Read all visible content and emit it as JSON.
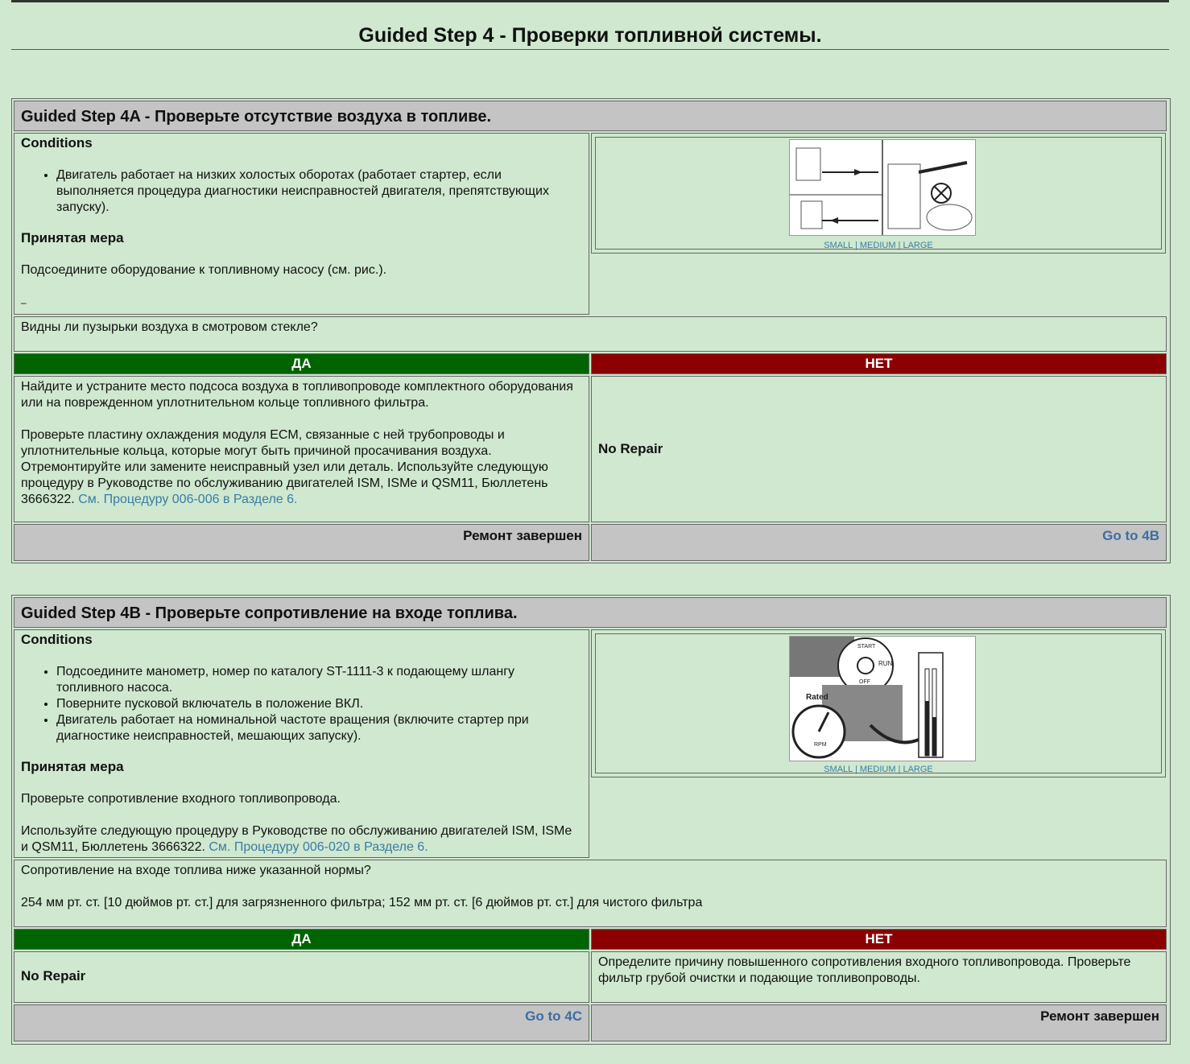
{
  "page_title": "Guided Step 4 - Проверки топливной системы.",
  "image_links": {
    "small": "SMALL",
    "medium": "MEDIUM",
    "large": "LARGE",
    "sep": " | "
  },
  "steps": [
    {
      "title": "Guided Step 4A - Проверьте отсутствие воздуха в топливе.",
      "conditions_label": "Conditions",
      "conditions": [
        "Двигатель работает на низких холостых оборотах (работает стартер, если выполняется процедура диагностики неисправностей двигателя, препятствующих запуску)."
      ],
      "action_label": "Принятая мера",
      "action_text": "Подсоедините оборудование к топливному насосу (см. рис.).",
      "action_extra": "–",
      "question": "Видны ли пузырьки воздуха в смотровом стекле?",
      "yes_label": "ДА",
      "no_label": "НЕТ",
      "yes_text_1": "Найдите и устраните место подсоса воздуха в топливопроводе комплектного оборудования или на поврежденном уплотнительном кольце топливного фильтра.",
      "yes_text_2": "Проверьте пластину охлаждения модуля ECM, связанные с ней трубопроводы и уплотнительные кольца, которые могут быть причиной просачивания воздуха. Отремонтируйте или замените неисправный узел или деталь. Используйте следующую процедуру в Руководстве по обслуживанию двигателей ISM, ISMe и QSM11, Бюллетень 3666322.",
      "yes_link": "См. Процедуру 006-006 в Разделе 6.",
      "no_text": "No Repair",
      "yes_footer": "Ремонт завершен",
      "no_footer": "Go to 4B"
    },
    {
      "title": "Guided Step 4B - Проверьте сопротивление на входе топлива.",
      "conditions_label": "Conditions",
      "conditions": [
        "Подсоедините манометр, номер по каталогу ST-1111-3 к подающему шлангу топливного насоса.",
        "Поверните пусковой включатель в положение ВКЛ.",
        "Двигатель работает на номинальной частоте вращения (включите стартер при диагностике неисправностей, мешающих запуску)."
      ],
      "action_label": "Принятая мера",
      "action_text": "Проверьте сопротивление входного топливопровода.",
      "action_text_2": "Используйте следующую процедуру в Руководстве по обслуживанию двигателей ISM, ISMe и QSM11, Бюллетень 3666322.",
      "action_link": "См. Процедуру 006-020 в Разделе 6.",
      "image_labels": {
        "start": "START",
        "run": "RUN",
        "off": "OFF",
        "rated": "Rated",
        "rpm": "RPM"
      },
      "question": "Сопротивление на входе топлива ниже указанной нормы?",
      "question_detail": "254 мм рт. ст. [10 дюймов рт. ст.] для загрязненного фильтра; 152 мм рт. ст. [6 дюймов рт. ст.] для чистого фильтра",
      "yes_label": "ДА",
      "no_label": "НЕТ",
      "yes_text": "No Repair",
      "no_text": "Определите причину повышенного сопротивления входного топливопровода. Проверьте фильтр грубой очистки и подающие топливопроводы.",
      "yes_footer": "Go to 4C",
      "no_footer": "Ремонт завершен"
    }
  ]
}
